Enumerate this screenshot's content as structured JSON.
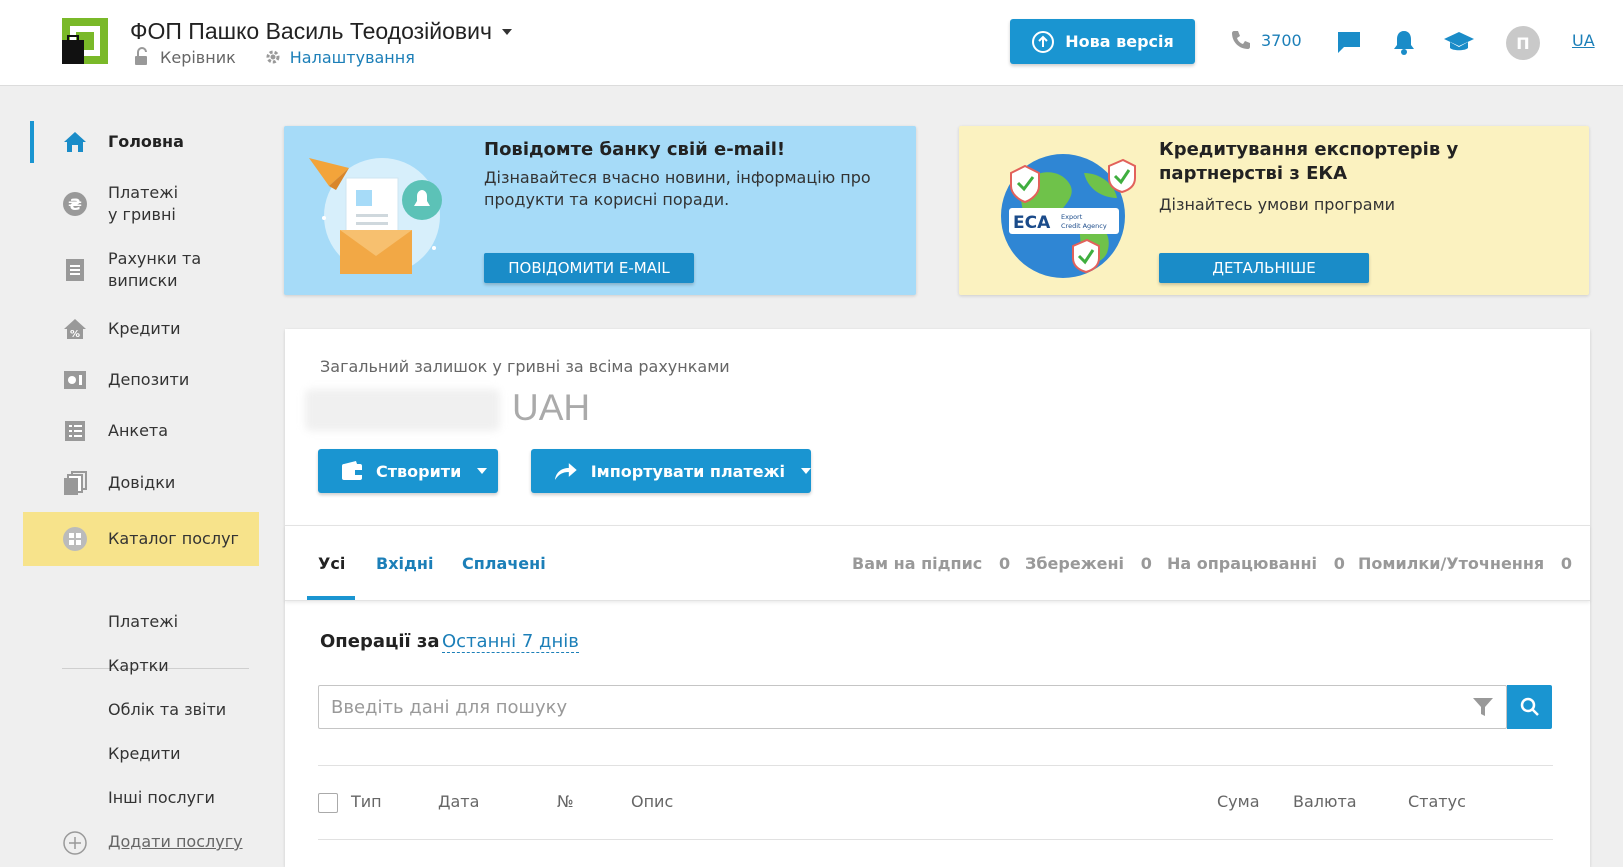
{
  "header": {
    "company_name": "ФОП Пашко Василь Теодозійович",
    "role": "Керівник",
    "settings": "Налаштування",
    "new_version": "Нова версія",
    "phone": "3700",
    "avatar": "П",
    "lang": "UA"
  },
  "sidebar": {
    "items": [
      {
        "label": "Головна"
      },
      {
        "label_line1": "Платежі",
        "label_line2": "у гривні"
      },
      {
        "label_line1": "Рахунки та",
        "label_line2": "виписки"
      },
      {
        "label": "Кредити"
      },
      {
        "label": "Депозити"
      },
      {
        "label": "Анкета"
      },
      {
        "label": "Довідки"
      },
      {
        "label": "Каталог послуг"
      }
    ],
    "services": [
      "Платежі",
      "Картки",
      "Облік та звіти",
      "Кредити",
      "Інші послуги"
    ],
    "add_service": "Додати послугу"
  },
  "banners": {
    "email": {
      "title": "Повідомте банку свій e-mail!",
      "text": "Дізнавайтеся вчасно новини, інформацію про продукти та корисні поради.",
      "button": "ПОВІДОМИТИ E-MAIL"
    },
    "export": {
      "title": "Кредитування експортерів у партнерстві з ЕКА",
      "text": "Дізнайтесь умови програми",
      "button": "ДЕТАЛЬНІШЕ",
      "logo_text": "ECA",
      "logo_sub": "Export Credit Agency"
    }
  },
  "balance": {
    "label": "Загальний залишок у гривні за всіма рахунками",
    "currency": "UAH"
  },
  "actions": {
    "create": "Створити",
    "import": "Імпортувати платежі"
  },
  "tabs": {
    "all": "Усі",
    "incoming": "Вхідні",
    "paid": "Сплачені"
  },
  "stats": [
    {
      "label": "Вам на підпис",
      "count": "0"
    },
    {
      "label": "Збережені",
      "count": "0"
    },
    {
      "label": "На опрацюванні",
      "count": "0"
    },
    {
      "label": "Помилки/Уточнення",
      "count": "0"
    }
  ],
  "operations": {
    "label": "Операції за",
    "period": "Останні 7 днів"
  },
  "search": {
    "placeholder": "Введіть дані для пошуку"
  },
  "table": {
    "columns": [
      "Тип",
      "Дата",
      "№",
      "Опис",
      "Сума",
      "Валюта",
      "Статус"
    ]
  },
  "colors": {
    "primary": "#1a95d1",
    "link": "#1c7fb8",
    "logo_green": "#7ab929",
    "highlight": "#f7e38b"
  }
}
